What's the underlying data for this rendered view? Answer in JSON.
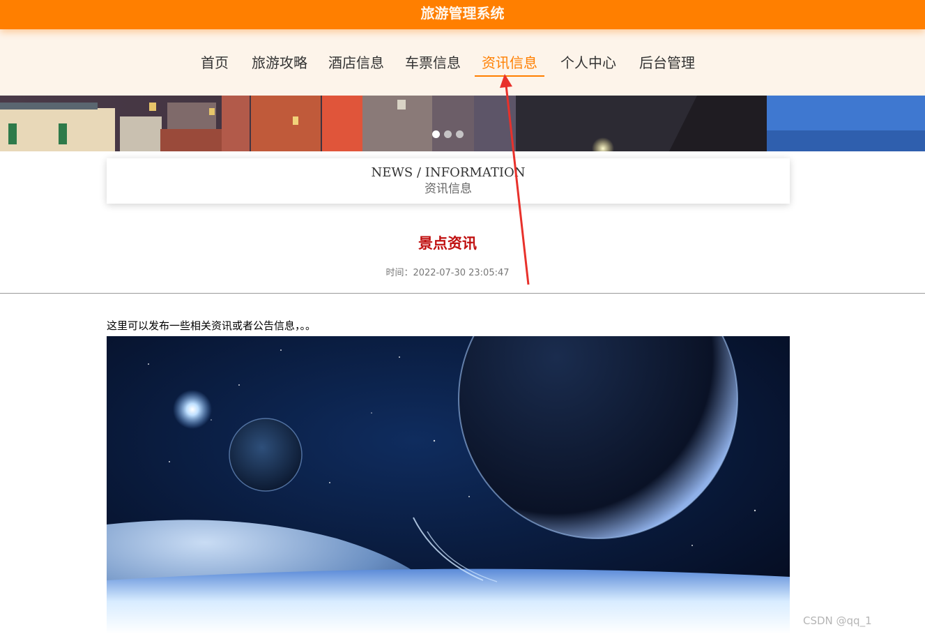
{
  "header": {
    "title": "旅游管理系统"
  },
  "nav": {
    "items": [
      {
        "label": "首页"
      },
      {
        "label": "旅游攻略"
      },
      {
        "label": "酒店信息"
      },
      {
        "label": "车票信息"
      },
      {
        "label": "资讯信息"
      },
      {
        "label": "个人中心"
      },
      {
        "label": "后台管理"
      }
    ],
    "active_label": "资讯信息"
  },
  "banner": {
    "slide_count": 3,
    "active_slide": 1
  },
  "section": {
    "title_en": "NEWS / INFORMATION",
    "title_cn": "资讯信息"
  },
  "article": {
    "title": "景点资讯",
    "time": "时间：2022-07-30 23:05:47",
    "body": "这里可以发布一些相关资讯或者公告信息，。。"
  },
  "watermark": "CSDN @qq_1"
}
